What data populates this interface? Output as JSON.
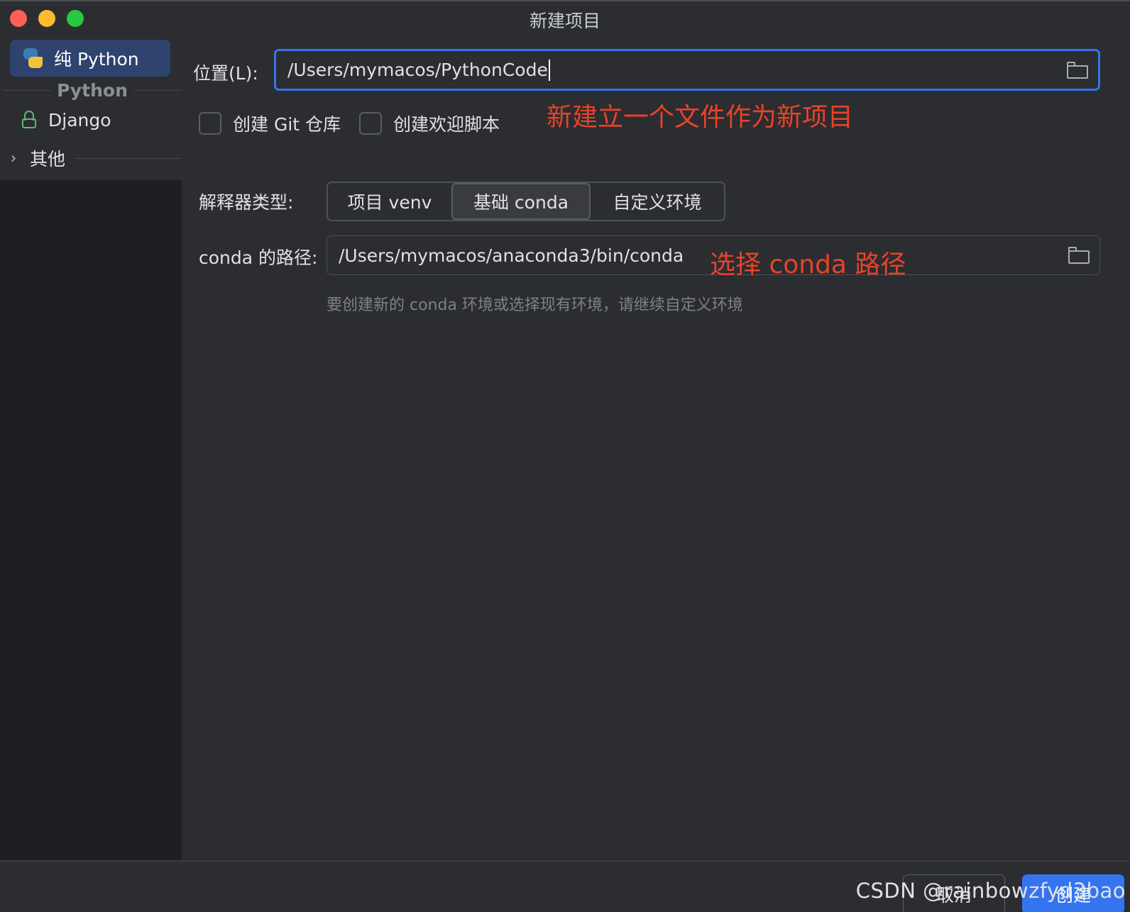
{
  "window": {
    "title": "新建项目"
  },
  "sidebar": {
    "selected": {
      "label": "纯 Python",
      "icon": "python-icon"
    },
    "section_label": "Python",
    "items": [
      {
        "label": "Django",
        "icon": "lock-icon"
      }
    ],
    "group": {
      "label": "其他",
      "icon": "chevron-right-icon"
    }
  },
  "form": {
    "location": {
      "label": "位置(L):",
      "value": "/Users/mymacos/PythonCode"
    },
    "checkboxes": [
      {
        "label": "创建 Git 仓库",
        "checked": false
      },
      {
        "label": "创建欢迎脚本",
        "checked": false
      }
    ],
    "interpreter": {
      "label": "解释器类型:",
      "options": [
        "项目 venv",
        "基础 conda",
        "自定义环境"
      ],
      "selected": "基础 conda"
    },
    "conda_path": {
      "label": "conda 的路径:",
      "value": "/Users/mymacos/anaconda3/bin/conda"
    },
    "hint": "要创建新的 conda 环境或选择现有环境，请继续自定义环境"
  },
  "annotations": {
    "location_note": "新建立一个文件作为新项目",
    "conda_note": "选择 conda 路径"
  },
  "footer": {
    "cancel_label": "取消",
    "create_label": "创建",
    "watermark": "CSDN @rainbowzfyd3bao"
  },
  "colors": {
    "accent": "#3574f0",
    "annotation": "#e8422a",
    "background": "#2b2d30",
    "sidebar": "#1e1f22"
  }
}
